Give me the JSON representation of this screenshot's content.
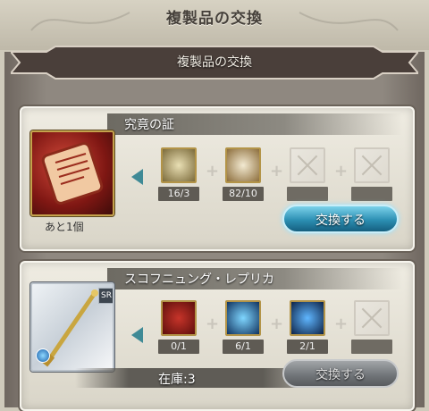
{
  "header": {
    "title": "複製品の交換"
  },
  "banner": {
    "title": "複製品の交換"
  },
  "items": [
    {
      "name": "究竟の証",
      "remaining": "あと1個",
      "materials": [
        {
          "icon": "scroll-icon",
          "count": "16/3"
        },
        {
          "icon": "scroll-badge-icon",
          "count": "82/10"
        },
        {
          "icon": "empty-slot-icon",
          "count": ""
        },
        {
          "icon": "empty-slot-icon",
          "count": ""
        }
      ],
      "button": "交換する",
      "button_state": "active"
    },
    {
      "name": "スコフニュング・レプリカ",
      "rarity": "SR",
      "stock": "在庫:3",
      "materials": [
        {
          "icon": "red-scroll-icon",
          "count": "0/1"
        },
        {
          "icon": "blue-orb-icon",
          "count": "6/1"
        },
        {
          "icon": "blue-crystal-icon",
          "count": "2/1"
        },
        {
          "icon": "empty-slot-icon",
          "count": ""
        }
      ],
      "button": "交換する",
      "button_state": "inactive"
    }
  ],
  "colors": {
    "button_active": "#2c8fb3",
    "button_inactive": "#6f7377",
    "frame": "#8f8880",
    "gold_border": "#c5a24c"
  }
}
